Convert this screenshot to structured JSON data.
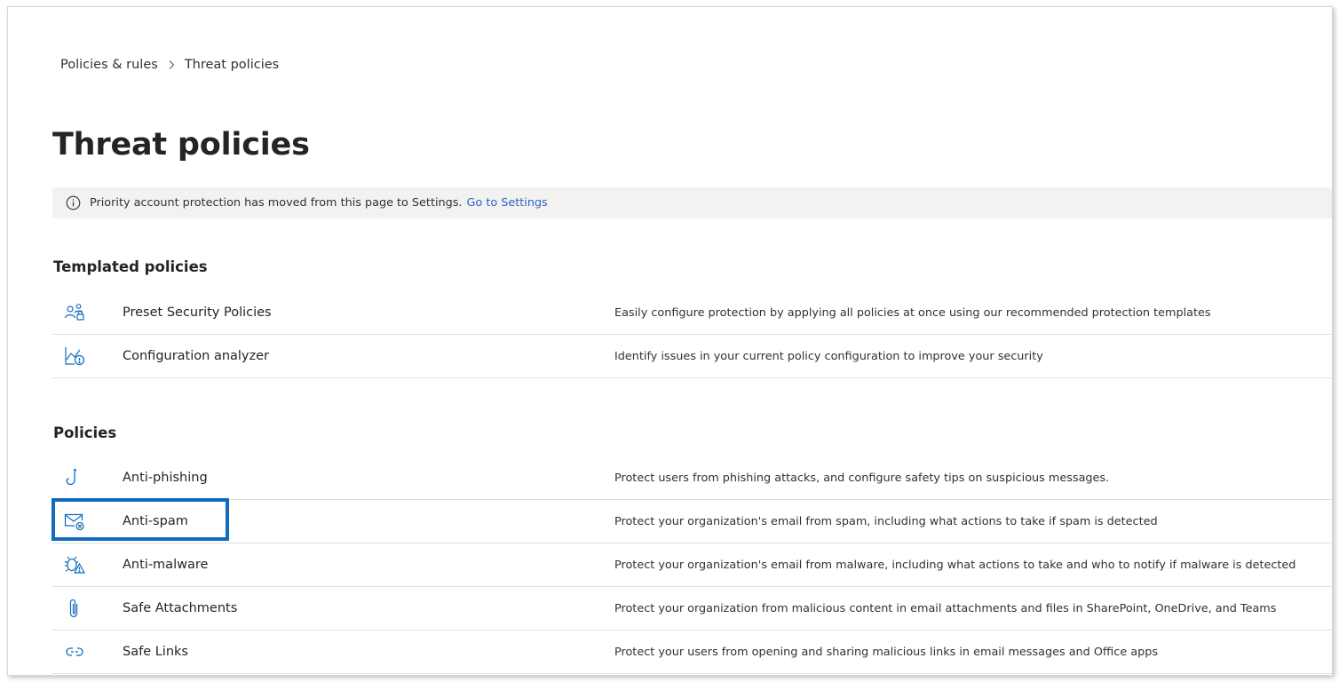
{
  "breadcrumb": {
    "items": [
      "Policies & rules",
      "Threat policies"
    ]
  },
  "page": {
    "title": "Threat policies"
  },
  "info_bar": {
    "message": "Priority account protection has moved from this page to Settings.",
    "link_label": "Go to Settings",
    "icon": "info-icon"
  },
  "sections": {
    "templated": {
      "heading": "Templated policies",
      "items": [
        {
          "icon": "preset-security-icon",
          "name": "Preset Security Policies",
          "description": "Easily configure protection by applying all policies at once using our recommended protection templates"
        },
        {
          "icon": "configuration-analyzer-icon",
          "name": "Configuration analyzer",
          "description": "Identify issues in your current policy configuration to improve your security"
        }
      ]
    },
    "policies": {
      "heading": "Policies",
      "items": [
        {
          "icon": "hook-icon",
          "name": "Anti-phishing",
          "description": "Protect users from phishing attacks, and configure safety tips on suspicious messages."
        },
        {
          "icon": "mail-block-icon",
          "name": "Anti-spam",
          "description": "Protect your organization's email from spam, including what actions to take if spam is detected",
          "highlighted": true
        },
        {
          "icon": "bug-warning-icon",
          "name": "Anti-malware",
          "description": "Protect your organization's email from malware, including what actions to take and who to notify if malware is detected"
        },
        {
          "icon": "paperclip-icon",
          "name": "Safe Attachments",
          "description": "Protect your organization from malicious content in email attachments and files in SharePoint, OneDrive, and Teams"
        },
        {
          "icon": "link-icon",
          "name": "Safe Links",
          "description": "Protect your users from opening and sharing malicious links in email messages and Office apps"
        }
      ]
    }
  },
  "colors": {
    "accent": "#0f6cbd",
    "link": "#2b64c0",
    "icon": "#0f6cbd",
    "info_bar_bg": "#f3f2f1"
  }
}
